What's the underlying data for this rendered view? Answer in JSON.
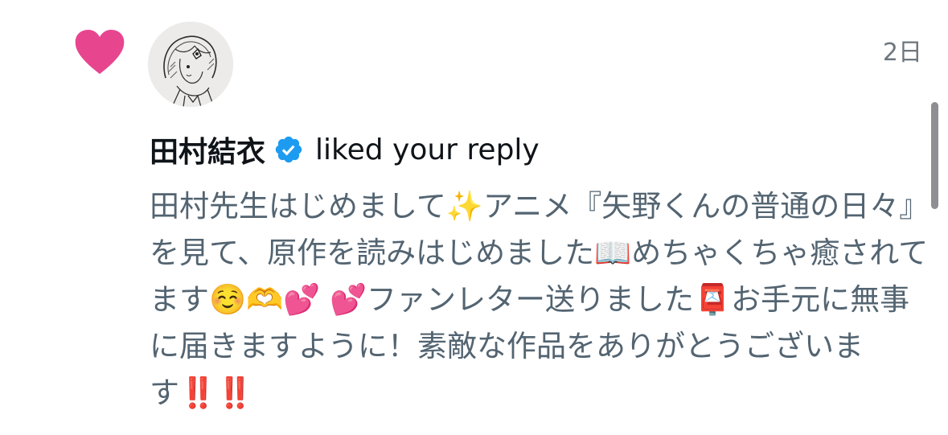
{
  "notification": {
    "timestamp": "2日",
    "user_name": "田村結衣",
    "action_text": "liked your reply",
    "reply_text": "田村先生はじめまして✨アニメ『矢野くんの普通の日々』を見て、原作を読みはじめました📖めちゃくちゃ癒されてます☺️🫶💕 💕ファンレター送りました📮お手元に無事に届きますように！素敵な作品をありがとうございます‼️‼️",
    "like_color": "#e8458f",
    "verified_color": "#1d9bf0",
    "icons": {
      "like": "heart-icon",
      "verified": "verified-badge-icon"
    }
  }
}
